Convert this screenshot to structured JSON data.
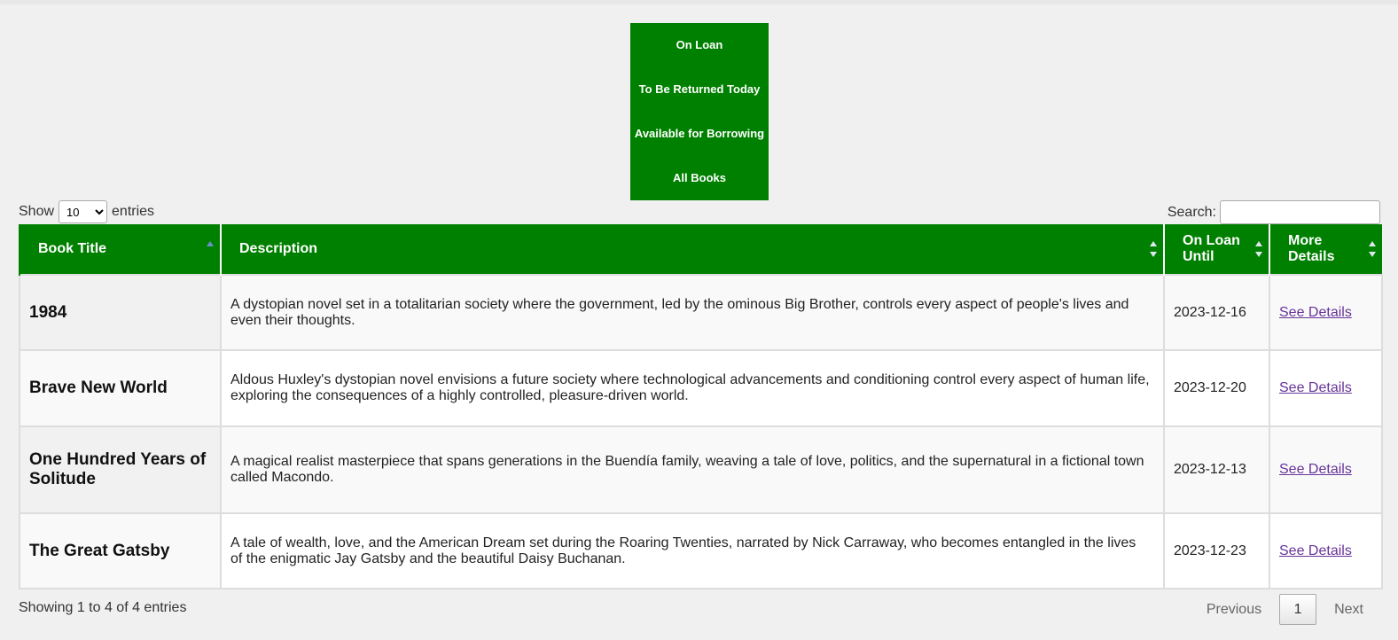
{
  "nav": {
    "items": [
      {
        "label": "On Loan"
      },
      {
        "label": "To Be Returned Today"
      },
      {
        "label": "Available for Borrowing"
      },
      {
        "label": "All Books"
      }
    ]
  },
  "length": {
    "prefix": "Show",
    "value": "10",
    "suffix": "entries"
  },
  "search": {
    "label": "Search:",
    "value": ""
  },
  "table": {
    "headers": [
      "Book Title",
      "Description",
      "On Loan Until",
      "More Details"
    ],
    "sorted_column": "Book Title",
    "rows": [
      {
        "title": "1984",
        "description": "A dystopian novel set in a totalitarian society where the government, led by the ominous Big Brother, controls every aspect of people's lives and even their thoughts.",
        "due": "2023-12-16",
        "link": "See Details"
      },
      {
        "title": "Brave New World",
        "description": "Aldous Huxley's dystopian novel envisions a future society where technological advancements and conditioning control every aspect of human life, exploring the consequences of a highly controlled, pleasure-driven world.",
        "due": "2023-12-20",
        "link": "See Details"
      },
      {
        "title": "One Hundred Years of Solitude",
        "description": "A magical realist masterpiece that spans generations in the Buendía family, weaving a tale of love, politics, and the supernatural in a fictional town called Macondo.",
        "due": "2023-12-13",
        "link": "See Details"
      },
      {
        "title": "The Great Gatsby",
        "description": "A tale of wealth, love, and the American Dream set during the Roaring Twenties, narrated by Nick Carraway, who becomes entangled in the lives of the enigmatic Jay Gatsby and the beautiful Daisy Buchanan.",
        "due": "2023-12-23",
        "link": "See Details"
      }
    ]
  },
  "info": "Showing 1 to 4 of 4 entries",
  "pagination": {
    "previous": "Previous",
    "current": "1",
    "next": "Next"
  },
  "colors": {
    "accent": "#008000",
    "link": "#663399",
    "background": "#f0f0f0"
  }
}
